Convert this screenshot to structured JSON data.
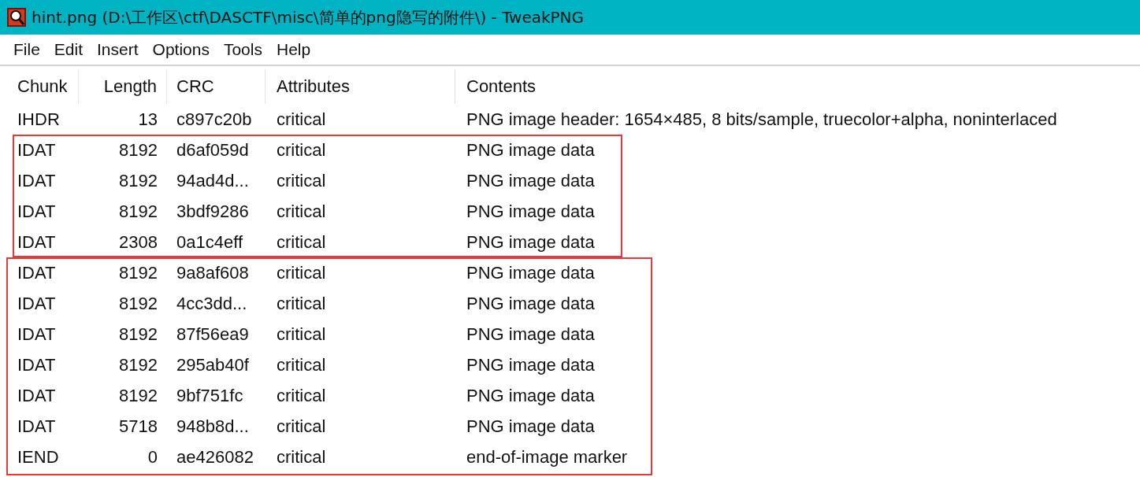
{
  "window": {
    "title": "hint.png (D:\\工作区\\ctf\\DASCTF\\misc\\简单的png隐写的附件\\) - TweakPNG"
  },
  "menu": [
    "File",
    "Edit",
    "Insert",
    "Options",
    "Tools",
    "Help"
  ],
  "table": {
    "columns": [
      "Chunk",
      "Length",
      "CRC",
      "Attributes",
      "Contents"
    ],
    "groups": [
      {
        "highlighted": false,
        "rows": [
          [
            "IHDR",
            "13",
            "c897c20b",
            "critical",
            "PNG image header: 1654×485, 8 bits/sample, truecolor+alpha, noninterlaced"
          ]
        ]
      },
      {
        "highlighted": true,
        "rows": [
          [
            "IDAT",
            "8192",
            "d6af059d",
            "critical",
            "PNG image data"
          ],
          [
            "IDAT",
            "8192",
            "94ad4d...",
            "critical",
            "PNG image data"
          ],
          [
            "IDAT",
            "8192",
            "3bdf9286",
            "critical",
            "PNG image data"
          ],
          [
            "IDAT",
            "2308",
            "0a1c4eff",
            "critical",
            "PNG image data"
          ]
        ]
      },
      {
        "highlighted": true,
        "rows": [
          [
            "IDAT",
            "8192",
            "9a8af608",
            "critical",
            "PNG image data"
          ],
          [
            "IDAT",
            "8192",
            "4cc3dd...",
            "critical",
            "PNG image data"
          ],
          [
            "IDAT",
            "8192",
            "87f56ea9",
            "critical",
            "PNG image data"
          ],
          [
            "IDAT",
            "8192",
            "295ab40f",
            "critical",
            "PNG image data"
          ],
          [
            "IDAT",
            "8192",
            "9bf751fc",
            "critical",
            "PNG image data"
          ],
          [
            "IDAT",
            "5718",
            "948b8d...",
            "critical",
            "PNG image data"
          ],
          [
            "IEND",
            "0",
            "ae426082",
            "critical",
            "end-of-image marker"
          ]
        ]
      }
    ]
  }
}
